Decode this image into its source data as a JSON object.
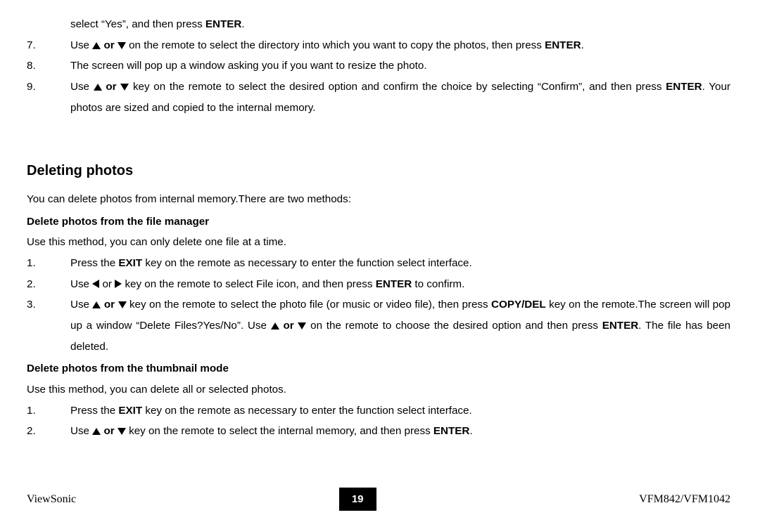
{
  "intro_indent": "select “Yes”, and then press ",
  "intro_indent_bold": "ENTER",
  "intro_indent_tail": ".",
  "top_list": [
    {
      "num": "7.",
      "pre": "Use ",
      "mid": " on the remote to select the directory into which you want to copy the photos, then press ",
      "bold": "ENTER",
      "tail": "."
    },
    {
      "num": "8.",
      "plain": "The screen will pop up a window asking you if you want to resize the photo."
    },
    {
      "num": "9.",
      "pre": "Use ",
      "mid": " key on the remote to select the desired option and confirm the choice by selecting “Confirm”, and then press ",
      "bold": "ENTER",
      "tail": ". Your photos are sized and copied to the internal memory."
    }
  ],
  "section_heading": "Deleting photos",
  "section_intro": "You can delete photos from internal memory.There are two methods:",
  "method_a_title": "Delete photos from the file manager",
  "method_a_intro": "Use this method, you can only delete one file at a time.",
  "method_a_list": {
    "i1": {
      "num": "1.",
      "a": "Press the ",
      "b": "EXIT",
      "c": " key on the remote as necessary to enter the function select interface."
    },
    "i2": {
      "num": "2.",
      "a": "Use ",
      "b": " key on the remote to select File icon, and then press ",
      "c": "ENTER",
      "d": " to confirm."
    },
    "i3": {
      "num": "3.",
      "a": "Use ",
      "b": " key on the remote to select the photo file (or music or video file), then press ",
      "c": "COPY/DEL",
      "d": " key on the remote.The screen will pop up a window “Delete Files?Yes/No”. Use ",
      "e": " on the remote to choose the desired option and then press ",
      "f": "ENTER",
      "g": ". The file has been deleted."
    }
  },
  "method_b_title": "Delete photos from the thumbnail mode",
  "method_b_intro": "Use this method, you can delete all or selected photos.",
  "method_b_list": {
    "i1": {
      "num": "1.",
      "a": "Press the ",
      "b": "EXIT",
      "c": " key on the remote as necessary to enter the function select interface."
    },
    "i2": {
      "num": "2.",
      "a": "Use ",
      "b": " key on the remote to select the internal memory, and then press ",
      "c": "ENTER",
      "d": "."
    }
  },
  "or_word": "or",
  "footer": {
    "left": "ViewSonic",
    "page": "19",
    "right": "VFM842/VFM1042"
  }
}
